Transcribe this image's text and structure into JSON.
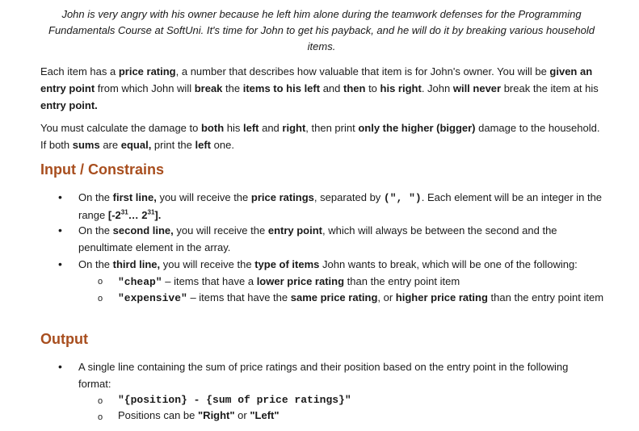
{
  "intro": {
    "line1": "John is very angry with his owner because he left him alone during the teamwork defenses for the Programming",
    "line2": "Fundamentals Course at SoftUni. It's time for John to get his payback, and he will do it by breaking various household",
    "line3": "items."
  },
  "para1": {
    "t1": "Each item has a ",
    "b1": "price rating",
    "t2": ", a number that describes how valuable that item is for John's owner. You will be ",
    "b2": "given an entry point",
    "t3": " from which John will ",
    "b3": "break",
    "t4": " the ",
    "b4": "items to his left",
    "t5": " and ",
    "b5": "then",
    "t6": " to ",
    "b6": "his right",
    "t7": ". John ",
    "b7": "will never",
    "t8": " break the item at his ",
    "b8": "entry point.",
    "t9": ""
  },
  "para2": {
    "t1": "You must calculate the damage to ",
    "b1": "both",
    "t2": " his ",
    "b2": "left",
    "t3": " and ",
    "b3": "right",
    "t4": ", then print ",
    "b4": "only the higher (bigger)",
    "t5": " damage to the household. If both ",
    "b5": "sums",
    "t6": " are ",
    "b6": "equal,",
    "t7": " print the ",
    "b7": "left",
    "t8": " one."
  },
  "heading_input": "Input / Constrains",
  "bullet_glyph": "•",
  "sub_bullet_glyph": "o",
  "input": {
    "item1": {
      "t1": "On the ",
      "b1": "first line,",
      "t2": " you will receive the ",
      "b2": "price ratings",
      "t3": ", separated by ",
      "code1": "(\", \")",
      "t4": ". Each element will be an integer in the range ",
      "b3_pre": "[-2",
      "sup1": "31",
      "b3_mid": "… 2",
      "sup2": "31",
      "b3_post": "]."
    },
    "item2": {
      "t1": "On the ",
      "b1": "second line,",
      "t2": " you will receive the ",
      "b2": "entry point",
      "t3": ", which will always be between the second and the penultimate element in the array."
    },
    "item3": {
      "t1": "On the ",
      "b1": "third line,",
      "t2": " you will receive the ",
      "b2": "type of items",
      "t3": " John wants to break, which will be one of the following:"
    },
    "sub1": {
      "code": "\"cheap\"",
      "t1": " – items that have a ",
      "b1": "lower price rating",
      "t2": " than the entry point item"
    },
    "sub2": {
      "code": "\"expensive\"",
      "t1": " – items that have the ",
      "b1": "same price rating",
      "t2": ", or ",
      "b2": "higher price rating",
      "t3": " than the entry point item"
    }
  },
  "heading_output": "Output",
  "output": {
    "item1": "A single line containing the sum of price ratings and their position based on the entry point in the following format:",
    "sub1_code": "\"{position} - {sum of price ratings}\"",
    "sub2": {
      "t1": "Positions can be ",
      "b1": "\"Right\"",
      "t2": " or ",
      "b2": "\"Left\""
    }
  }
}
